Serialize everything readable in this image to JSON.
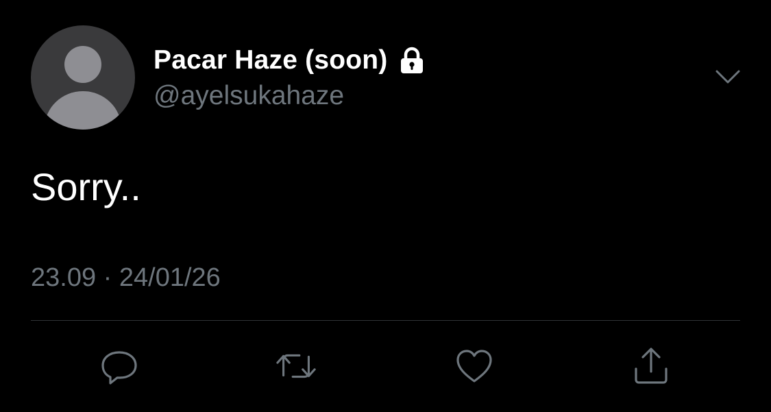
{
  "tweet": {
    "author": {
      "display_name": "Pacar Haze (soon)",
      "username": "@ayelsukahaze",
      "protected_icon": "lock-icon",
      "avatar": "default-avatar-placeholder"
    },
    "text": "Sorry..",
    "meta": "23.09 · 24/01/26"
  },
  "actions": {
    "icons": [
      "reply-icon",
      "retweet-icon",
      "like-icon",
      "share-icon"
    ]
  },
  "colors": {
    "background": "#000000",
    "primary_text": "#ffffff",
    "secondary_text": "#6e767d",
    "divider": "#2f3336",
    "avatar_bg": "#3a3a3c",
    "avatar_figure": "#8e8e93"
  }
}
